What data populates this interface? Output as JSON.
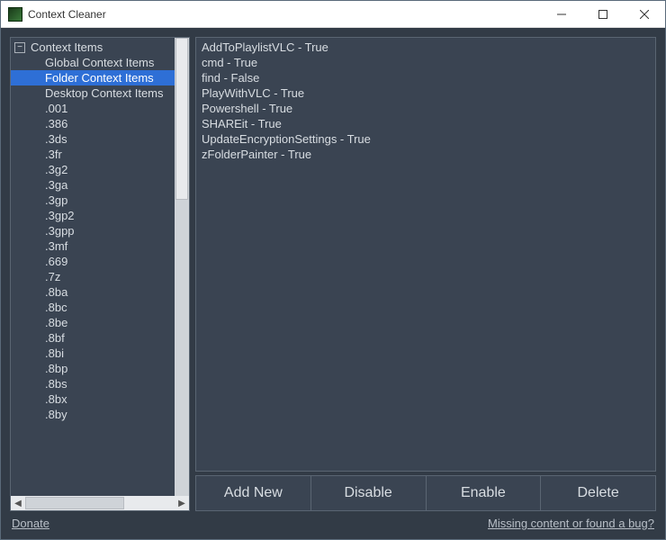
{
  "window": {
    "title": "Context Cleaner"
  },
  "tree": {
    "root_label": "Context Items",
    "categories": [
      {
        "label": "Global Context Items",
        "selected": false
      },
      {
        "label": "Folder Context Items",
        "selected": true
      },
      {
        "label": "Desktop Context Items",
        "selected": false
      }
    ],
    "extensions": [
      ".001",
      ".386",
      ".3ds",
      ".3fr",
      ".3g2",
      ".3ga",
      ".3gp",
      ".3gp2",
      ".3gpp",
      ".3mf",
      ".669",
      ".7z",
      ".8ba",
      ".8bc",
      ".8be",
      ".8bf",
      ".8bi",
      ".8bp",
      ".8bs",
      ".8bx",
      ".8by"
    ]
  },
  "details": [
    {
      "name": "AddToPlaylistVLC",
      "enabled": "True"
    },
    {
      "name": "cmd",
      "enabled": "True"
    },
    {
      "name": "find",
      "enabled": "False"
    },
    {
      "name": "PlayWithVLC",
      "enabled": "True"
    },
    {
      "name": "Powershell",
      "enabled": "True"
    },
    {
      "name": "SHAREit",
      "enabled": "True"
    },
    {
      "name": "UpdateEncryptionSettings",
      "enabled": "True"
    },
    {
      "name": "zFolderPainter",
      "enabled": "True"
    }
  ],
  "buttons": {
    "add": "Add New",
    "disable": "Disable",
    "enable": "Enable",
    "delete": "Delete"
  },
  "footer": {
    "donate": "Donate",
    "bug": "Missing content or found a bug?"
  }
}
